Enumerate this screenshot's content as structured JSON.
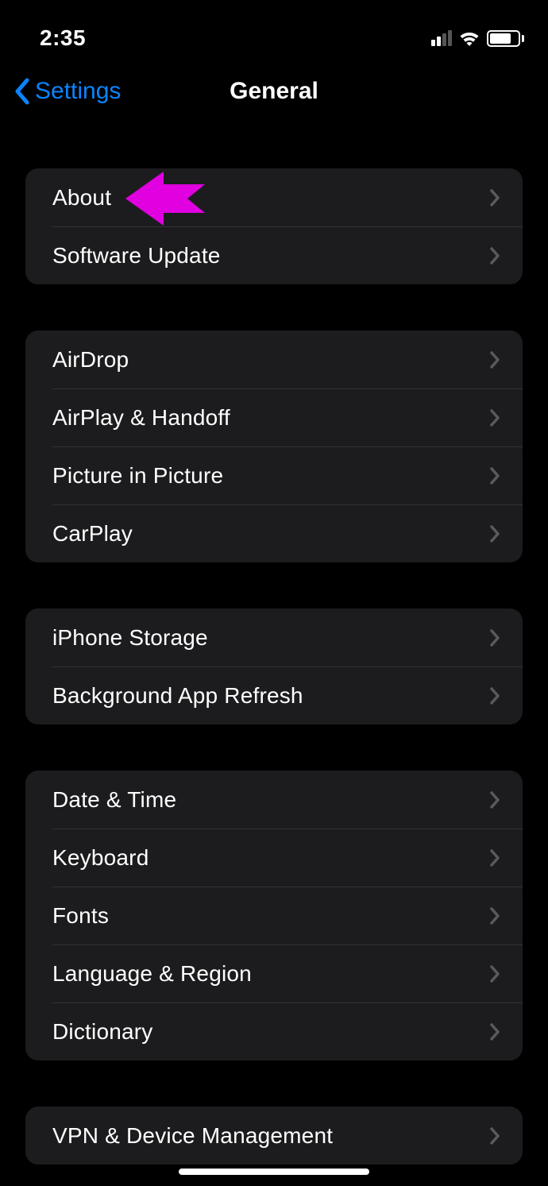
{
  "status": {
    "time": "2:35"
  },
  "nav": {
    "back_label": "Settings",
    "title": "General"
  },
  "groups": [
    {
      "items": [
        {
          "label": "About",
          "key": "about"
        },
        {
          "label": "Software Update",
          "key": "software-update"
        }
      ]
    },
    {
      "items": [
        {
          "label": "AirDrop",
          "key": "airdrop"
        },
        {
          "label": "AirPlay & Handoff",
          "key": "airplay-handoff"
        },
        {
          "label": "Picture in Picture",
          "key": "picture-in-picture"
        },
        {
          "label": "CarPlay",
          "key": "carplay"
        }
      ]
    },
    {
      "items": [
        {
          "label": "iPhone Storage",
          "key": "iphone-storage"
        },
        {
          "label": "Background App Refresh",
          "key": "background-app-refresh"
        }
      ]
    },
    {
      "items": [
        {
          "label": "Date & Time",
          "key": "date-time"
        },
        {
          "label": "Keyboard",
          "key": "keyboard"
        },
        {
          "label": "Fonts",
          "key": "fonts"
        },
        {
          "label": "Language & Region",
          "key": "language-region"
        },
        {
          "label": "Dictionary",
          "key": "dictionary"
        }
      ]
    },
    {
      "items": [
        {
          "label": "VPN & Device Management",
          "key": "vpn-device-management"
        }
      ]
    }
  ],
  "colors": {
    "accent": "#0a84ff",
    "annotation": "#e000e0"
  }
}
